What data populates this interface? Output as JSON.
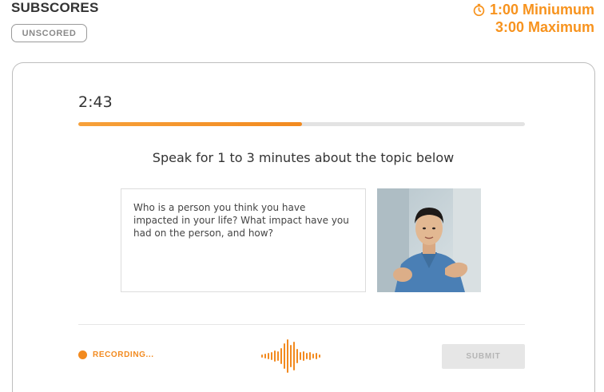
{
  "header": {
    "title": "SUBSCORES",
    "badge": "UNSCORED",
    "timer_icon": "stopwatch-icon",
    "min_time": "1:00 Miniumum",
    "max_time": "3:00 Maximum"
  },
  "task": {
    "time_remaining": "2:43",
    "progress": 0.5,
    "instruction": "Speak for 1 to 3 minutes about the topic below",
    "prompt": "Who is a person you think you have impacted in your life? What impact have you had on the person, and how?"
  },
  "footer": {
    "recording_label": "RECORDING...",
    "submit_label": "SUBMIT",
    "submit_enabled": false
  },
  "colors": {
    "accent": "#f28a1f",
    "track": "#e3e3e3",
    "disabled_button": "#e6e6e6"
  }
}
